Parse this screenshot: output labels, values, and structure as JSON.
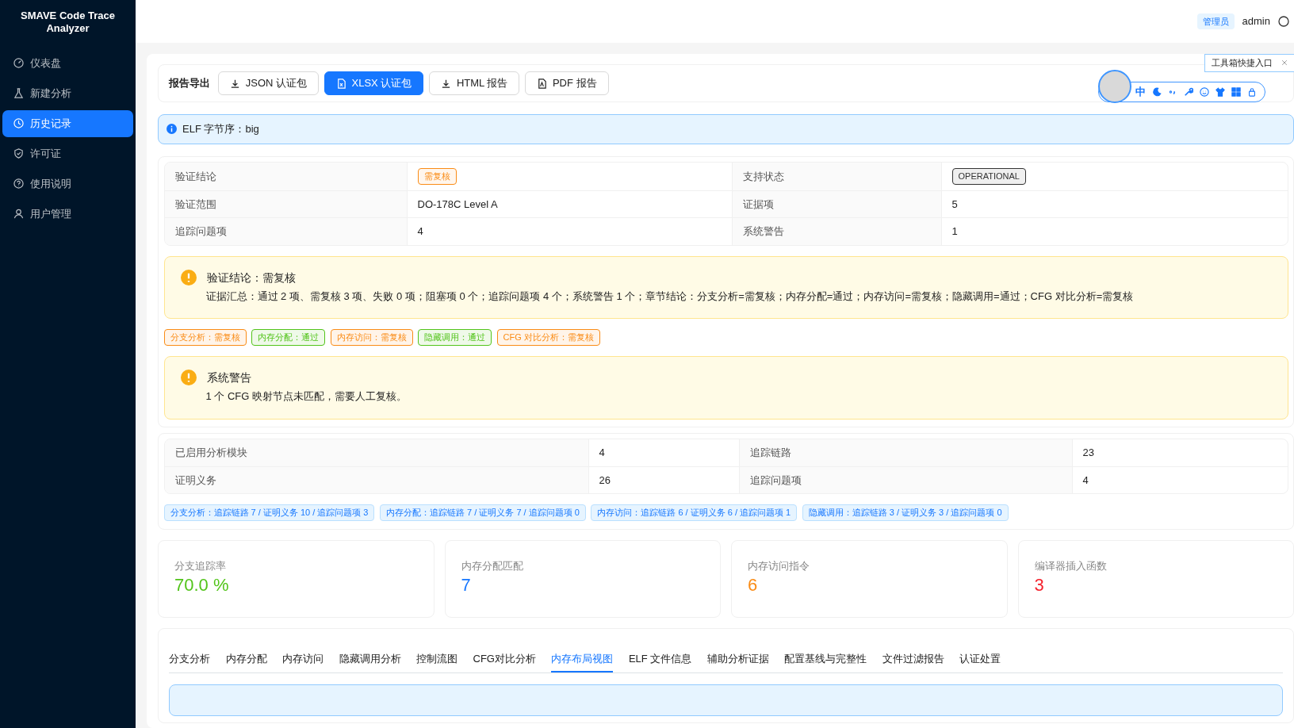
{
  "sidebar": {
    "brand": "SMAVE Code Trace Analyzer",
    "items": [
      {
        "label": "仪表盘",
        "selected": false
      },
      {
        "label": "新建分析",
        "selected": false
      },
      {
        "label": "历史记录",
        "selected": true
      },
      {
        "label": "许可证",
        "selected": false
      },
      {
        "label": "使用说明",
        "selected": false
      },
      {
        "label": "用户管理",
        "selected": false
      }
    ]
  },
  "header": {
    "role": "管理员",
    "user": "admin"
  },
  "export": {
    "label": "报告导出",
    "buttons": [
      {
        "label": "JSON 认证包",
        "kind": "download",
        "selected": false
      },
      {
        "label": "XLSX 认证包",
        "kind": "sheet",
        "selected": true
      },
      {
        "label": "HTML 报告",
        "kind": "download",
        "selected": false
      },
      {
        "label": "PDF 报告",
        "kind": "pdf",
        "selected": false
      }
    ]
  },
  "widget": {
    "tooltip": "工具箱快捷入口",
    "glyph": "中"
  },
  "info_alert": {
    "text": "ELF 字节序：big"
  },
  "summary": {
    "rows": [
      [
        {
          "label": "验证结论",
          "value": "需复核",
          "kind": "tag",
          "color": "#fa8c16"
        },
        {
          "label": "支持状态",
          "value": "OPERATIONAL",
          "kind": "tag",
          "color": "#333333"
        }
      ],
      [
        {
          "label": "验证范围",
          "value": "DO-178C Level A",
          "kind": "text"
        },
        {
          "label": "证据项",
          "value": "5",
          "kind": "text"
        }
      ],
      [
        {
          "label": "追踪问题项",
          "value": "4",
          "kind": "text"
        },
        {
          "label": "系统警告",
          "value": "1",
          "kind": "text"
        }
      ]
    ],
    "verdict": {
      "title": "验证结论：需复核",
      "text": "证据汇总：通过 2 项、需复核 3 项、失败 0 项；阻塞项 0 个；追踪问题项 4 个；系统警告 1 个；章节结论：分支分析=需复核；内存分配=通过；内存访问=需复核；隐藏调用=通过；CFG 对比分析=需复核"
    },
    "tags": [
      {
        "text": "分支分析：需复核",
        "color": "#fa8c16"
      },
      {
        "text": "内存分配：通过",
        "color": "#52c41a"
      },
      {
        "text": "内存访问：需复核",
        "color": "#fa8c16"
      },
      {
        "text": "隐藏调用：通过",
        "color": "#52c41a"
      },
      {
        "text": "CFG 对比分析：需复核",
        "color": "#fa8c16"
      }
    ],
    "warning": {
      "title": "系统警告",
      "text": "1 个 CFG 映射节点未匹配，需要人工复核。"
    }
  },
  "modules": {
    "rows": [
      [
        {
          "label": "已启用分析模块",
          "value": "4"
        },
        {
          "label": "追踪链路",
          "value": "23"
        }
      ],
      [
        {
          "label": "证明义务",
          "value": "26"
        },
        {
          "label": "追踪问题项",
          "value": "4"
        }
      ]
    ],
    "tags": [
      "分支分析：追踪链路 7 / 证明义务 10 / 追踪问题项 3",
      "内存分配：追踪链路 7 / 证明义务 7 / 追踪问题项 0",
      "内存访问：追踪链路 6 / 证明义务 6 / 追踪问题项 1",
      "隐藏调用：追踪链路 3 / 证明义务 3 / 追踪问题项 0"
    ]
  },
  "stats": [
    {
      "label": "分支追踪率",
      "value": "70.0 %",
      "color": "#52c41a"
    },
    {
      "label": "内存分配匹配",
      "value": "7",
      "color": "#1677ff"
    },
    {
      "label": "内存访问指令",
      "value": "6",
      "color": "#fa8c16"
    },
    {
      "label": "编译器插入函数",
      "value": "3",
      "color": "#f5222d"
    }
  ],
  "tabs": [
    {
      "label": "分支分析",
      "selected": false
    },
    {
      "label": "内存分配",
      "selected": false
    },
    {
      "label": "内存访问",
      "selected": false
    },
    {
      "label": "隐藏调用分析",
      "selected": false
    },
    {
      "label": "控制流图",
      "selected": false
    },
    {
      "label": "CFG对比分析",
      "selected": false
    },
    {
      "label": "内存布局视图",
      "selected": true
    },
    {
      "label": "ELF 文件信息",
      "selected": false
    },
    {
      "label": "辅助分析证据",
      "selected": false
    },
    {
      "label": "配置基线与完整性",
      "selected": false
    },
    {
      "label": "文件过滤报告",
      "selected": false
    },
    {
      "label": "认证处置",
      "selected": false
    }
  ]
}
